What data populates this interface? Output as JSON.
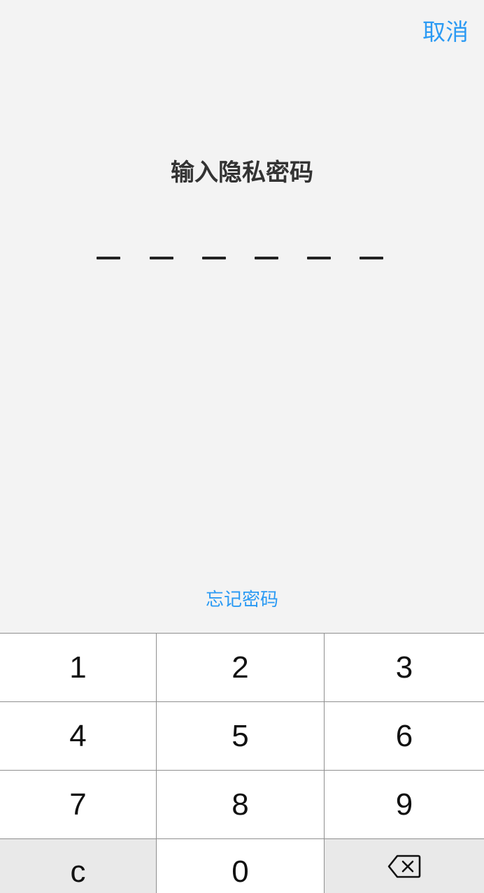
{
  "header": {
    "cancel_label": "取消"
  },
  "passcode": {
    "title": "输入隐私密码",
    "length": 6,
    "entered": 0
  },
  "forgot_label": "忘记密码",
  "keypad": {
    "keys": [
      "1",
      "2",
      "3",
      "4",
      "5",
      "6",
      "7",
      "8",
      "9",
      "c",
      "0"
    ],
    "backspace_icon": "backspace-icon"
  },
  "colors": {
    "accent": "#2b9af3",
    "background": "#f3f3f3",
    "title": "#333333",
    "divider": "#8f8f8f"
  }
}
